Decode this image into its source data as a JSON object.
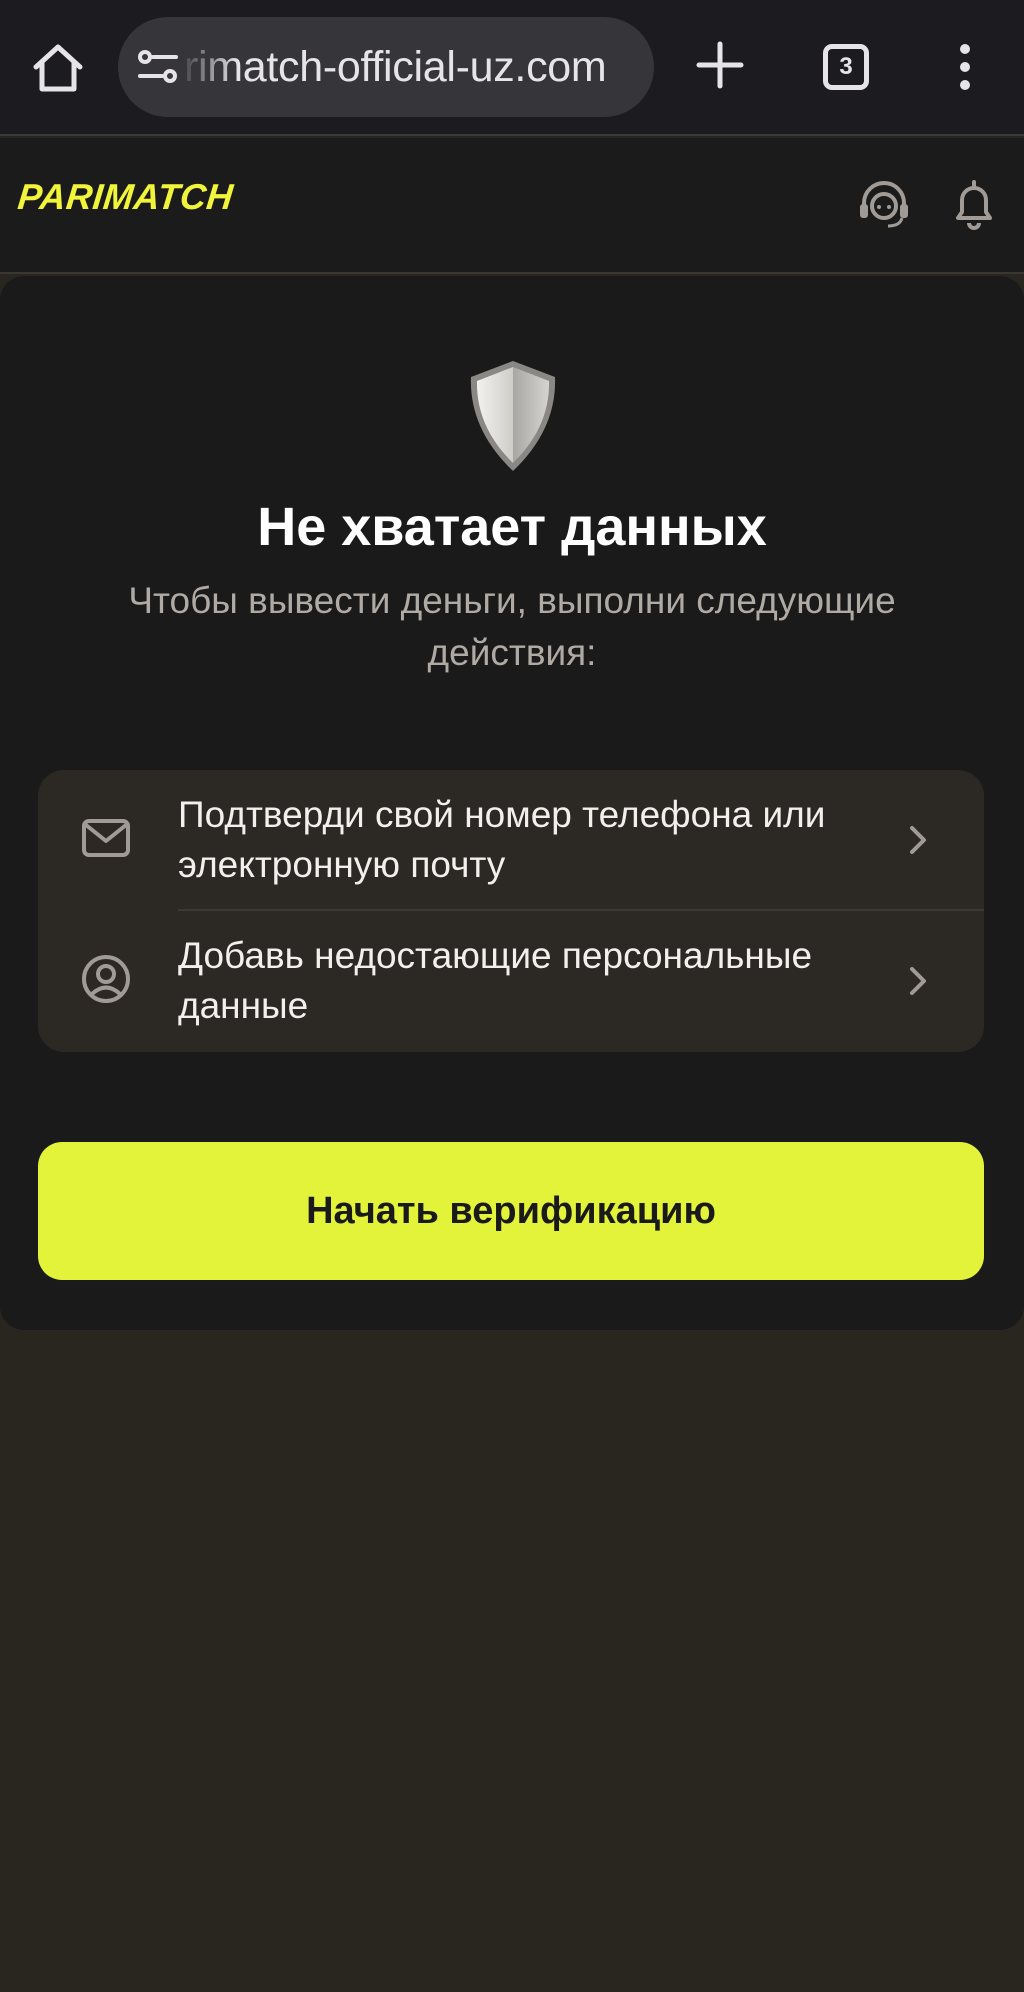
{
  "browser": {
    "url": "rimatch-official-uz.com",
    "tab_count": "3"
  },
  "header": {
    "logo_text": "PARIMATCH"
  },
  "main": {
    "title": "Не хватает данных",
    "subtitle": "Чтобы вывести деньги, выполни следующие действия:",
    "steps": [
      {
        "label": "Подтверди свой номер телефона или электронную почту",
        "icon": "mail-icon"
      },
      {
        "label": "Добавь недостающие персональные данные",
        "icon": "user-circle-icon"
      }
    ],
    "cta_label": "Начать верификацию"
  },
  "colors": {
    "accent": "#e2f33a",
    "background": "#29251f",
    "card": "#1b1a1a"
  }
}
